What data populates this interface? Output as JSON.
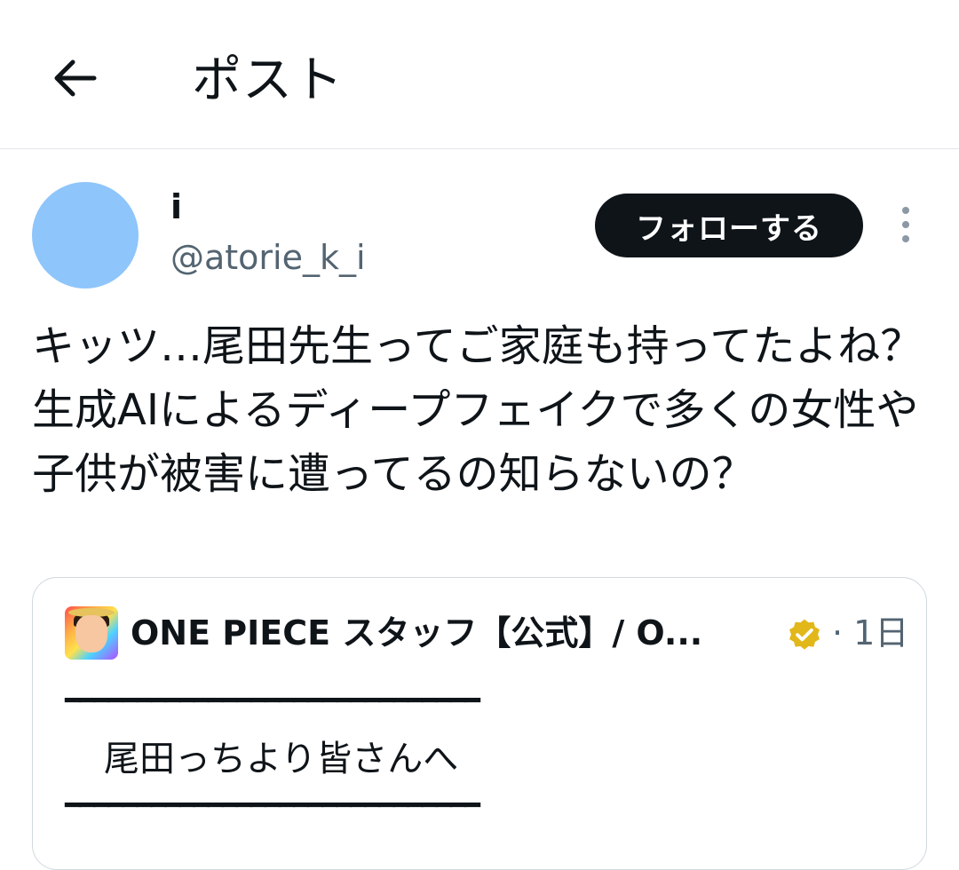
{
  "header": {
    "title": "ポスト",
    "back_icon": "arrow-left-icon"
  },
  "author": {
    "display_name": "i",
    "handle": "@atorie_k_i",
    "avatar_color": "#8ec5fb"
  },
  "follow_button": {
    "label": "フォローする"
  },
  "more_icon": "more-vertical-icon",
  "post": {
    "text": "キッツ…尾田先生ってご家庭も持ってたよね？生成AIによるディープフェイクで多くの女性や子供が被害に遭ってるの知らないの？"
  },
  "quote": {
    "author_name": "ONE PIECE スタッフ【公式】/ O...",
    "verified_icon": "verified-badge-icon",
    "time": "· 1日",
    "rule": "━━━━━━━━━━━━━━━━━━━━━━━━━━━━━",
    "line": "尾田っちより皆さんへ"
  },
  "colors": {
    "text": "#0f1419",
    "secondary": "#536471",
    "button_bg": "#0f1419",
    "border": "#cfd9de",
    "verified": "#e2b719"
  }
}
